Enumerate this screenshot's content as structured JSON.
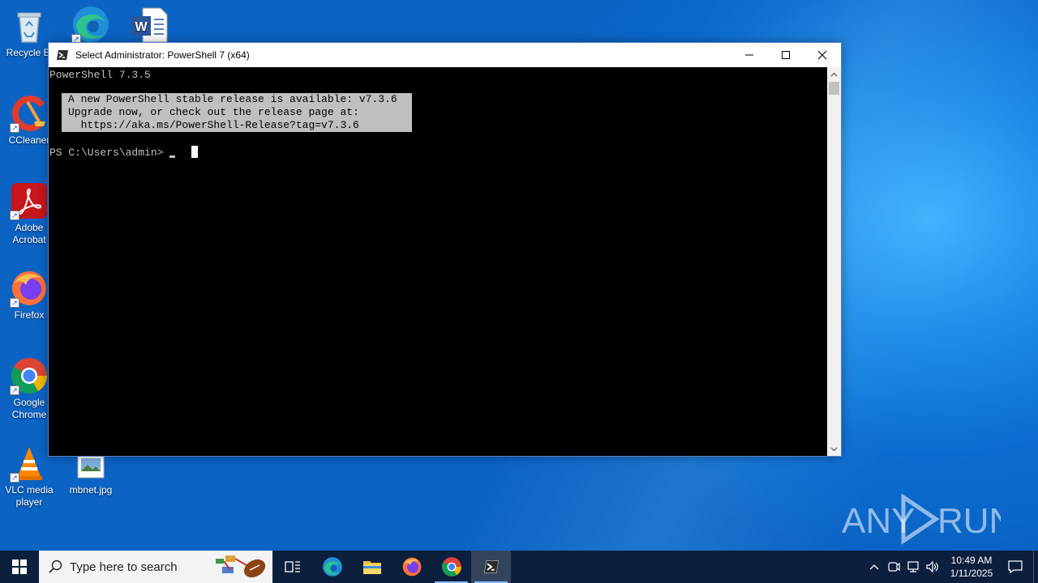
{
  "desktop": {
    "icons": [
      {
        "label": "Recycle Bin",
        "icon": "recycle-bin-icon"
      },
      {
        "label": "",
        "icon": "edge-icon"
      },
      {
        "label": "",
        "icon": "word-document-icon"
      },
      {
        "label": "CCleaner",
        "icon": "ccleaner-icon"
      },
      {
        "label": "Adobe Acrobat",
        "icon": "adobe-acrobat-icon"
      },
      {
        "label": "Firefox",
        "icon": "firefox-icon"
      },
      {
        "label": "Google Chrome",
        "icon": "chrome-icon"
      },
      {
        "label": "VLC media player",
        "icon": "vlc-icon"
      },
      {
        "label": "mbnet.jpg",
        "icon": "image-file-icon"
      }
    ],
    "recycle_label": "Recycle Bi",
    "ccleaner_label": "CCleaner",
    "acrobat_label_1": "Adobe",
    "acrobat_label_2": "Acrobat",
    "firefox_label": "Firefox",
    "chrome_label_1": "Google",
    "chrome_label_2": "Chrome",
    "vlc_label_1": "VLC media",
    "vlc_label_2": "player",
    "mbnet_label": "mbnet.jpg"
  },
  "window": {
    "title": "Select Administrator: PowerShell 7 (x64)",
    "controls": {
      "minimize": "minimize",
      "maximize": "maximize",
      "close": "close"
    }
  },
  "console": {
    "version_line": "PowerShell 7.3.5",
    "notice_lines": [
      "A new PowerShell stable release is available: v7.3.6",
      "Upgrade now, or check out the release page at:",
      "  https://aka.ms/PowerShell-Release?tag=v7.3.6"
    ],
    "prompt": "PS C:\\Users\\admin> "
  },
  "taskbar": {
    "search_placeholder": "Type here to search",
    "apps": [
      "task-view",
      "edge",
      "file-explorer",
      "firefox",
      "chrome",
      "powershell"
    ],
    "active_app": "powershell",
    "clock_time": "10:49 AM",
    "clock_date": "1/11/2025"
  },
  "watermark": {
    "text": "ANY RUN"
  },
  "colors": {
    "console_bg": "#000000",
    "console_fg": "#c0c0c0",
    "taskbar_bg": "#0c1f3d",
    "desktop_blue": "#0b63c4"
  }
}
